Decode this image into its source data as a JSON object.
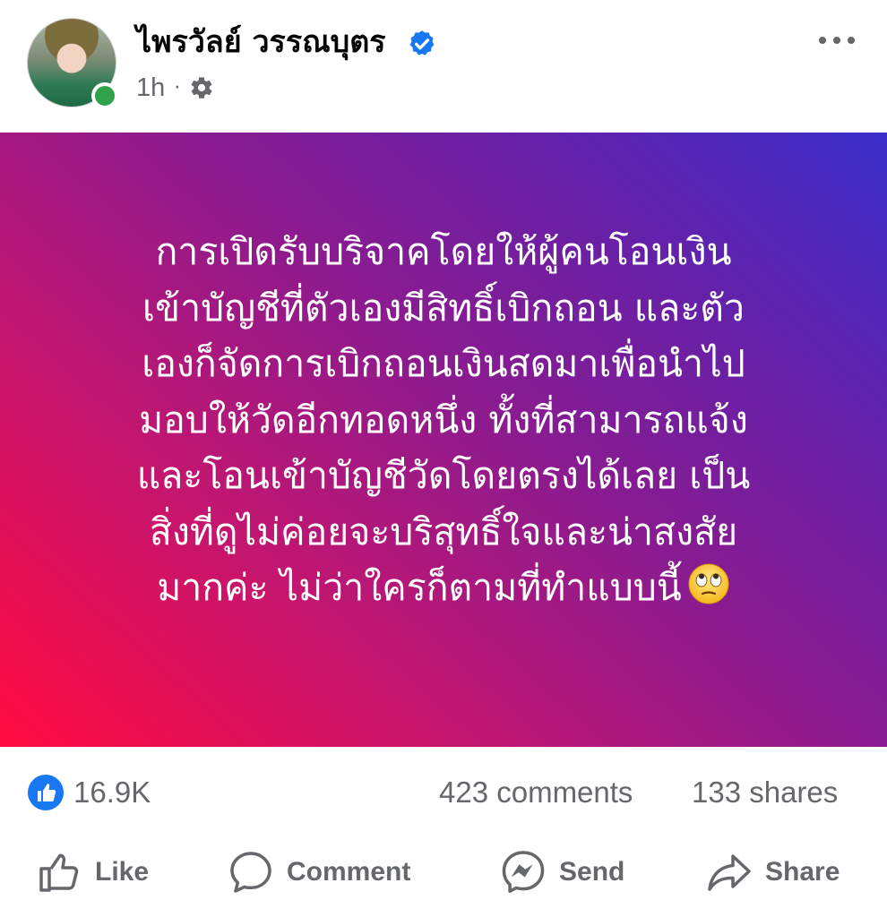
{
  "post": {
    "author": "ไพรวัลย์ วรรณบุตร",
    "time": "1h",
    "meta_separator": "·",
    "text": "การเปิดรับบริจาคโดยให้ผู้คนโอนเงิน\nเข้าบัญชีที่ตัวเองมีสิทธิ์เบิกถอน และตัว\nเองก็จัดการเบิกถอนเงินสดมาเพื่อนำไป\nมอบให้วัดอีกทอดหนึ่ง ทั้งที่สามารถแจ้ง\nและโอนเข้าบัญชีวัดโดยตรงได้เลย   เป็น\nสิ่งที่ดูไม่ค่อยจะบริสุทธิ์ใจและน่าสงสัย\nมากค่ะ    ไม่ว่าใครก็ตามที่ทำแบบนี้",
    "emoji": "face-with-rolling-eyes",
    "background_gradient": [
      "#ff0a3f",
      "#8b1b8f",
      "#3a2ec9"
    ]
  },
  "stats": {
    "likes": "16.9K",
    "comments": "423 comments",
    "shares": "133 shares"
  },
  "actions": {
    "like": "Like",
    "comment": "Comment",
    "send": "Send",
    "share": "Share"
  },
  "icons": {
    "verified": "verified-badge-icon",
    "audience": "gear-icon",
    "more": "more-options-icon",
    "like_reaction": "like-reaction-icon"
  },
  "colors": {
    "accent": "#1877f2",
    "muted_text": "#65676b",
    "online": "#31a24c"
  }
}
